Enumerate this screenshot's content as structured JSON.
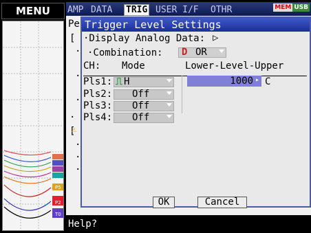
{
  "menu_label": "MENU",
  "tabs": [
    "AMP",
    "DATA",
    "TRIG",
    "USER I/F",
    "OTHR"
  ],
  "status_badges": [
    "MEM",
    "USB"
  ],
  "background_panel": {
    "title_partial": "Pe",
    "lines_partial": [
      "[",
      "·",
      "·",
      "·",
      "·",
      "[",
      "·",
      "·",
      "·"
    ]
  },
  "dialog": {
    "title": "Trigger Level Settings",
    "display_analog_label": "·Display Analog Data:",
    "display_analog_icon": "▷",
    "combination_label": "·Combination:",
    "combination_value": "OR",
    "columns": {
      "ch": "CH:",
      "mode": "Mode",
      "range": "Lower-Level-Upper"
    },
    "rows": [
      {
        "label": "Pls1:",
        "mode": "H",
        "value": "1000",
        "unit": "C"
      },
      {
        "label": "Pls2:",
        "mode": "Off"
      },
      {
        "label": "Pls3:",
        "mode": "Off"
      },
      {
        "label": "Pls4:",
        "mode": "Off"
      }
    ],
    "ok_label": "OK",
    "cancel_label": "Cancel"
  },
  "help_text": "Help?",
  "channel_labels": [
    "P5",
    "P2",
    "T0"
  ],
  "colors": {
    "tab_bar": "#1a2a6a",
    "dialog_title": "#2a40b0",
    "value_highlight": "#8080d8",
    "trigger_green": "#1a9a30",
    "or_red": "#d02020"
  }
}
